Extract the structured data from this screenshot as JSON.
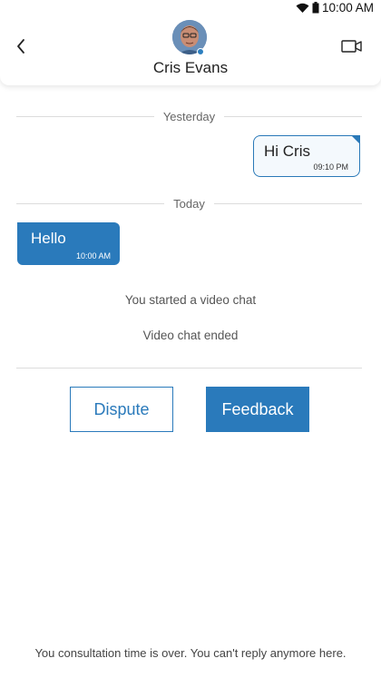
{
  "status_bar": {
    "time": "10:00 AM",
    "icons": [
      "wifi-icon",
      "battery-icon"
    ]
  },
  "header": {
    "contact_name": "Cris Evans",
    "online": true,
    "back_icon": "chevron-left-icon",
    "video_icon": "video-camera-icon"
  },
  "conversation": {
    "dividers": {
      "yesterday": "Yesterday",
      "today": "Today"
    },
    "messages": [
      {
        "direction": "outgoing",
        "text": "Hi Cris",
        "time": "09:10 PM"
      },
      {
        "direction": "incoming",
        "text": "Hello",
        "time": "10:00 AM"
      }
    ],
    "system_messages": [
      "You started a video chat",
      "Video chat ended"
    ]
  },
  "actions": {
    "dispute_label": "Dispute",
    "feedback_label": "Feedback"
  },
  "footer": {
    "note": "You consultation time is over. You can't reply anymore here."
  },
  "colors": {
    "accent": "#2a7abb",
    "outgoing_bubble_bg": "#f4f9fd",
    "divider": "#dcdcdc"
  }
}
